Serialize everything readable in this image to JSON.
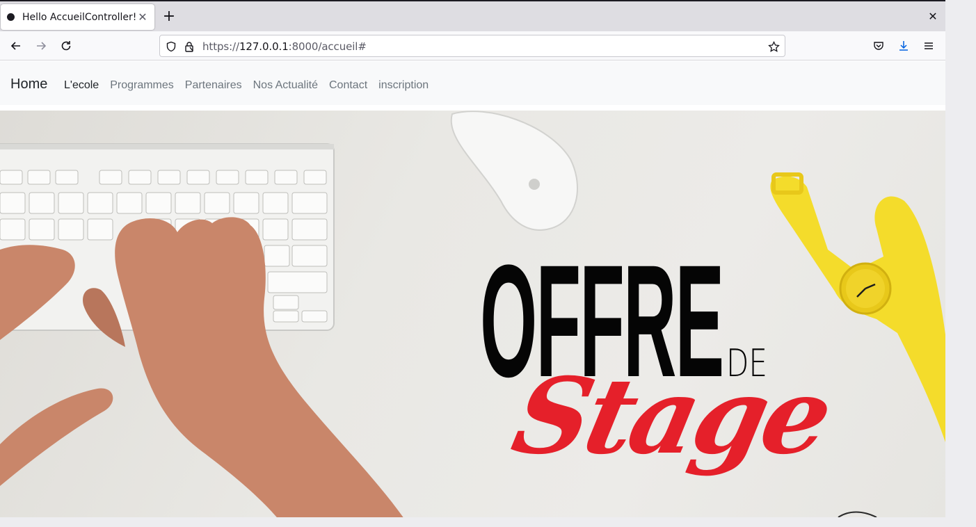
{
  "browser": {
    "tab": {
      "title": "Hello AccueilController!"
    },
    "url": {
      "scheme": "https://",
      "host": "127.0.0.1",
      "rest": ":8000/accueil#"
    },
    "icons": [
      "back-icon",
      "forward-icon",
      "reload-icon",
      "shield-icon",
      "lock-icon",
      "star-icon",
      "pocket-icon",
      "download-icon",
      "menu-icon",
      "close-icon",
      "plus-icon"
    ]
  },
  "site": {
    "brand": "Home",
    "nav": [
      {
        "label": "L'ecole",
        "active": true
      },
      {
        "label": "Programmes",
        "active": false
      },
      {
        "label": "Partenaires",
        "active": false
      },
      {
        "label": "Nos Actualité",
        "active": false
      },
      {
        "label": "Contact",
        "active": false
      },
      {
        "label": "inscription",
        "active": false
      }
    ],
    "hero": {
      "title_line1": "OFFRE",
      "title_small": "DE",
      "title_line2": "Stage",
      "colors": {
        "title_black": "#050505",
        "title_red": "#e5202a",
        "watch_yellow": "#f4dc2b"
      }
    }
  }
}
